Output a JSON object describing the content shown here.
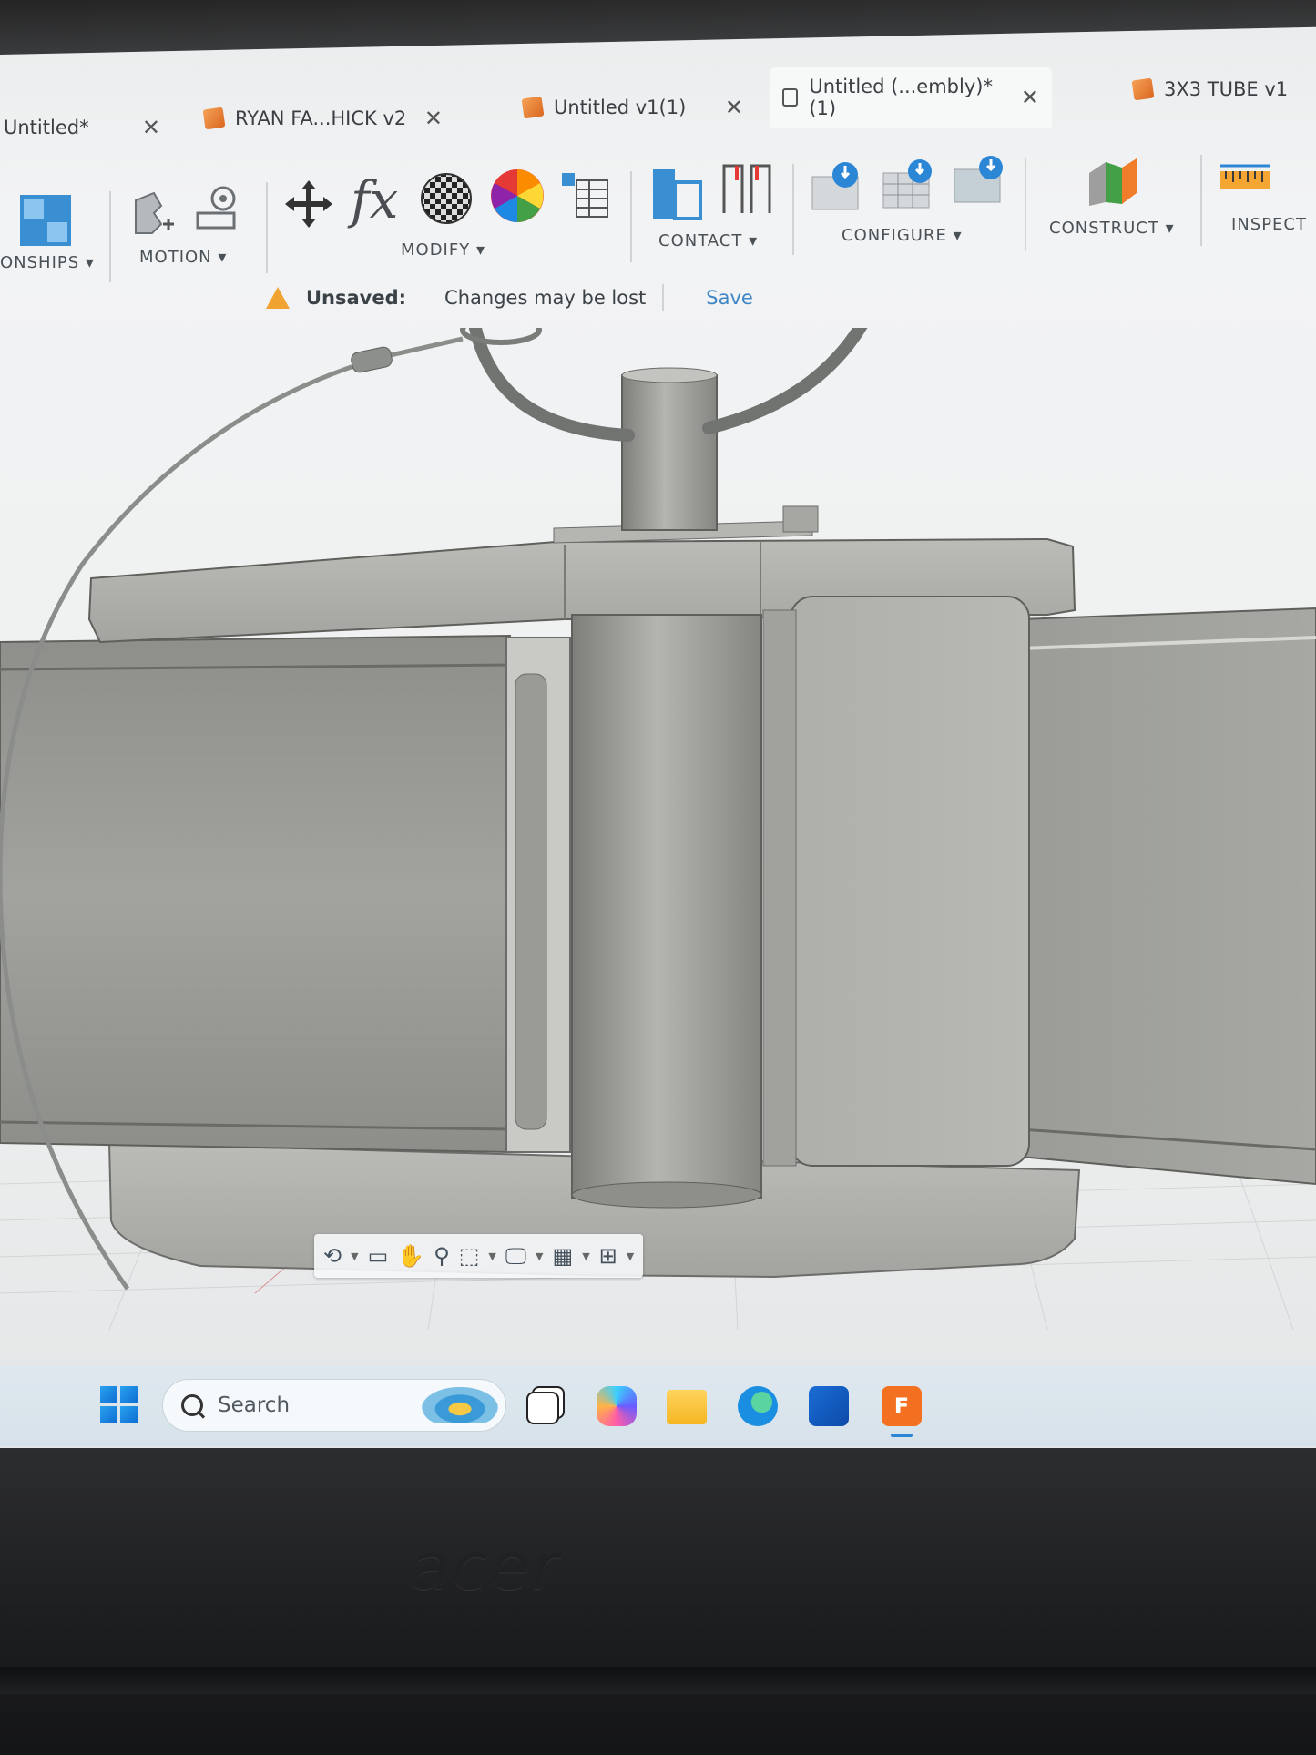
{
  "tabs": [
    {
      "label": "Untitled*",
      "active": false,
      "icon": "none"
    },
    {
      "label": "RYAN FA...HICK v2",
      "active": false,
      "icon": "orange-cube-icon"
    },
    {
      "label": "Untitled v1(1)",
      "active": false,
      "icon": "orange-cube-icon"
    },
    {
      "label": "Untitled (...embly)*(1)",
      "active": true,
      "icon": "lock-icon"
    },
    {
      "label": "3X3 TUBE v1",
      "active": false,
      "icon": "orange-cube-icon"
    }
  ],
  "toolbar": {
    "relationships_label": "ONSHIPS",
    "motion_label": "MOTION",
    "modify_label": "MODIFY",
    "contact_label": "CONTACT",
    "configure_label": "CONFIGURE",
    "construct_label": "CONSTRUCT",
    "inspect_label": "INSPECT"
  },
  "status": {
    "unsaved_label": "Unsaved:",
    "message": "Changes may be lost",
    "save_label": "Save"
  },
  "taskbar": {
    "search_placeholder": "Search",
    "fusion_badge": "F"
  },
  "laptop": {
    "brand": "acer"
  },
  "colors": {
    "accent": "#3f86c6",
    "warning": "#f0a331",
    "brand_orange": "#e8731f",
    "model_gray": "#a9aaa6"
  }
}
